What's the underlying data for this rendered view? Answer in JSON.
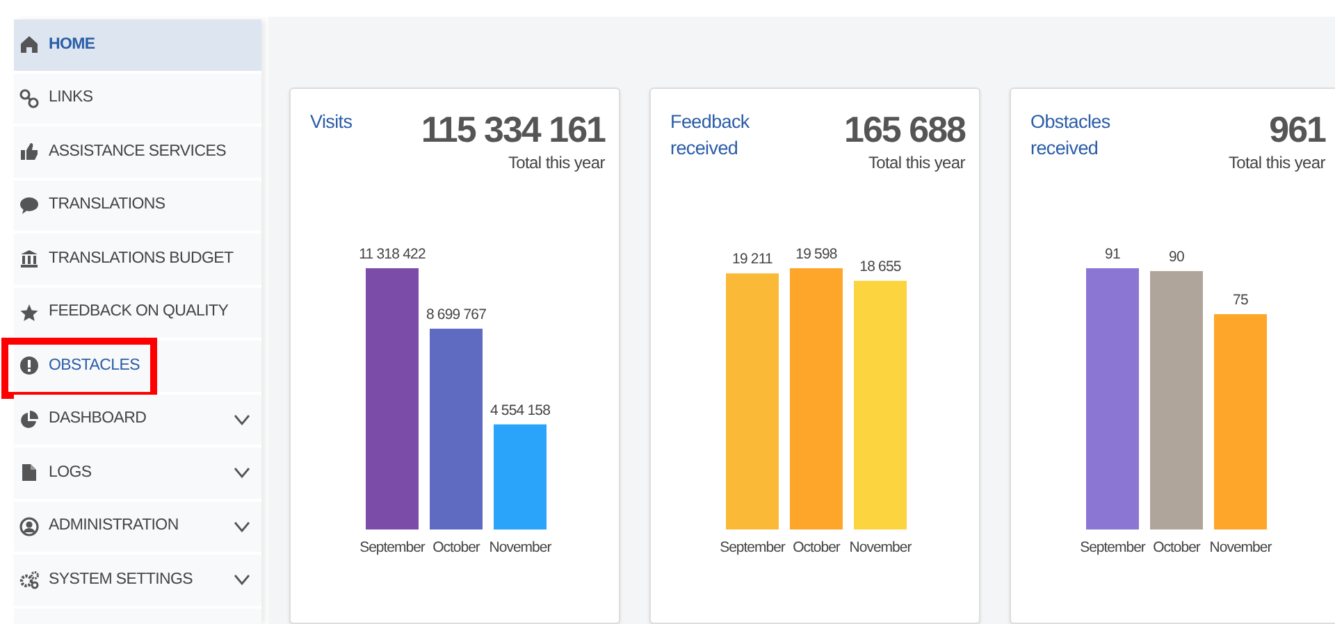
{
  "sidebar": {
    "items": [
      {
        "label": "HOME",
        "selected": true,
        "active": true,
        "highlighted": false
      },
      {
        "label": "LINKS",
        "selected": false,
        "active": false,
        "highlighted": false
      },
      {
        "label": "ASSISTANCE SERVICES",
        "selected": false,
        "active": false,
        "highlighted": false
      },
      {
        "label": "TRANSLATIONS",
        "selected": false,
        "active": false,
        "highlighted": false
      },
      {
        "label": "TRANSLATIONS BUDGET",
        "selected": false,
        "active": false,
        "highlighted": false
      },
      {
        "label": "FEEDBACK ON QUALITY",
        "selected": false,
        "active": false,
        "highlighted": false
      },
      {
        "label": "OBSTACLES",
        "selected": false,
        "active": true,
        "highlighted": true
      },
      {
        "label": "DASHBOARD",
        "selected": false,
        "active": false,
        "highlighted": false,
        "expanded": false
      },
      {
        "label": "LOGS",
        "selected": false,
        "active": false,
        "highlighted": false,
        "expanded": false
      },
      {
        "label": "ADMINISTRATION",
        "selected": false,
        "active": false,
        "highlighted": false,
        "expanded": false
      },
      {
        "label": "SYSTEM SETTINGS",
        "selected": false,
        "active": false,
        "highlighted": false,
        "expanded": false
      }
    ]
  },
  "cards": [
    {
      "title": "Visits",
      "total": "115 334 161",
      "total_caption": "Total this year",
      "chart_data": {
        "type": "bar",
        "categories": [
          "September",
          "October",
          "November"
        ],
        "data_labels": true,
        "value_labels": [
          "11 318 422",
          "8 699 767",
          "4 554 158"
        ],
        "series": [
          {
            "colors": [
              "#7b4ca8",
              "#5e6bc0",
              "#2aa3fb"
            ],
            "values": [
              11318422,
              8699767,
              4554158
            ]
          }
        ]
      }
    },
    {
      "title": "Feedback received",
      "total": "165 688",
      "total_caption": "Total this year",
      "chart_data": {
        "type": "bar",
        "categories": [
          "September",
          "October",
          "November"
        ],
        "data_labels": true,
        "value_labels": [
          "19 211",
          "19 598",
          "18 655"
        ],
        "series": [
          {
            "colors": [
              "#fbb938",
              "#fda629",
              "#fbd43f"
            ],
            "values": [
              19211,
              19598,
              18655
            ]
          }
        ]
      }
    },
    {
      "title": "Obstacles received",
      "total": "961",
      "total_caption": "Total this year",
      "chart_data": {
        "type": "bar",
        "categories": [
          "September",
          "October",
          "November"
        ],
        "data_labels": true,
        "value_labels": [
          "91",
          "90",
          "75"
        ],
        "series": [
          {
            "colors": [
              "#8b76d4",
              "#b0a59b",
              "#fea629"
            ],
            "values": [
              91,
              90,
              75
            ]
          }
        ]
      }
    }
  ]
}
